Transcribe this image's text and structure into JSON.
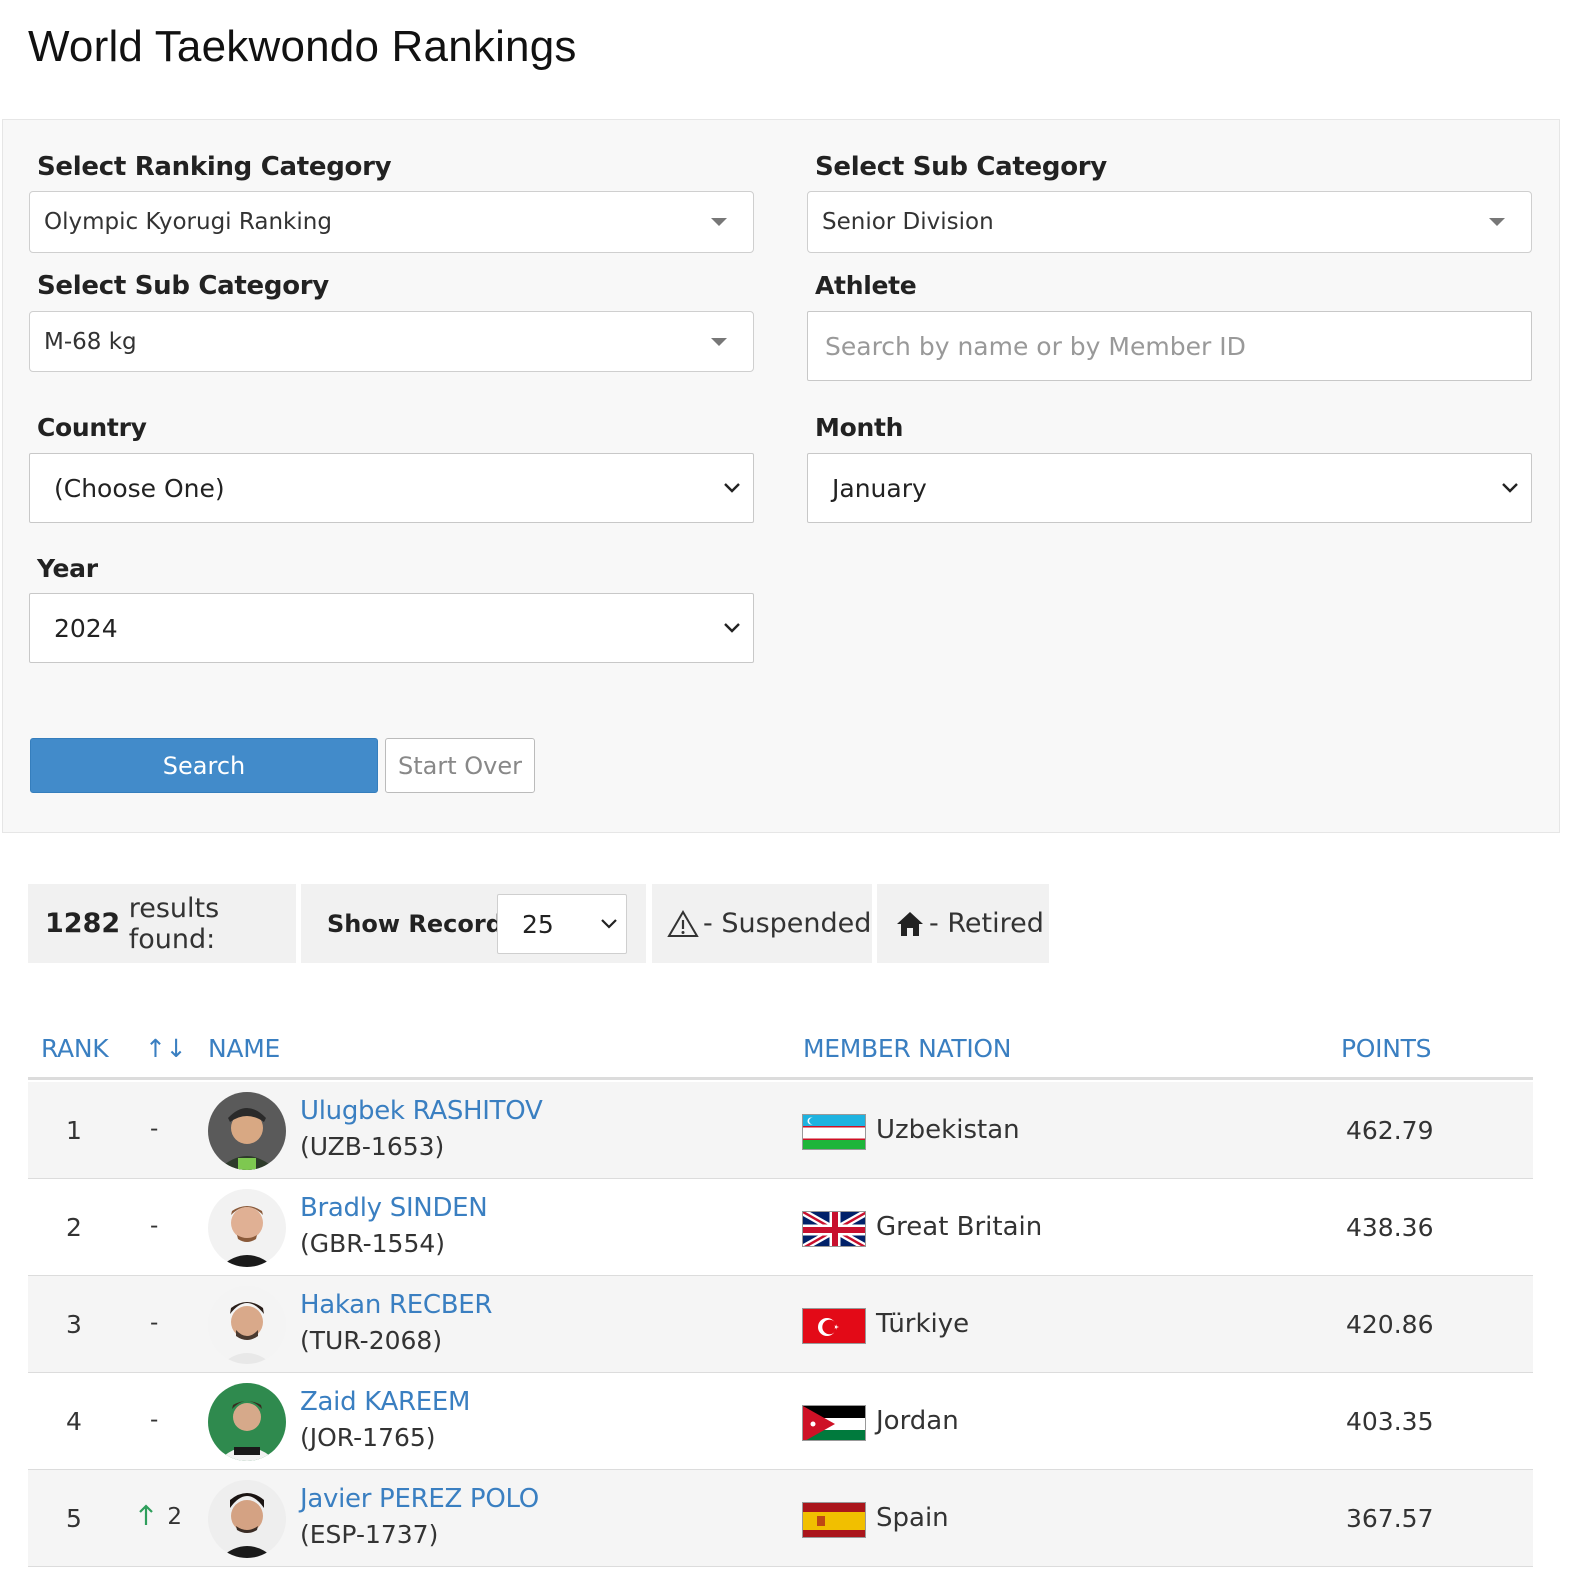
{
  "page": {
    "title": "World Taekwondo Rankings"
  },
  "filters": {
    "ranking_category": {
      "label": "Select Ranking Category",
      "value": "Olympic Kyorugi Ranking"
    },
    "sub_category_division": {
      "label": "Select Sub Category",
      "value": "Senior Division"
    },
    "sub_category_weight": {
      "label": "Select Sub Category",
      "value": "M-68 kg"
    },
    "athlete": {
      "label": "Athlete",
      "placeholder": "Search by name or by Member ID"
    },
    "country": {
      "label": "Country",
      "value": "(Choose One)"
    },
    "month": {
      "label": "Month",
      "value": "January"
    },
    "year": {
      "label": "Year",
      "value": "2024"
    },
    "search_label": "Search",
    "start_over_label": "Start Over"
  },
  "results": {
    "count": "1282",
    "count_suffix": "results found:",
    "show_records_label": "Show Records:",
    "show_records_value": "25",
    "suspended_label": "- Suspended",
    "retired_label": "- Retired"
  },
  "table": {
    "headers": {
      "rank": "RANK",
      "sort": "↑↓",
      "name": "NAME",
      "nation": "MEMBER NATION",
      "points": "POINTS"
    },
    "rows": [
      {
        "rank": "1",
        "change": "-",
        "change_dir": "none",
        "name": "Ulugbek RASHITOV",
        "member_id": "(UZB-1653)",
        "nation": "Uzbekistan",
        "flag": "uzbekistan-flag",
        "points": "462.79"
      },
      {
        "rank": "2",
        "change": "-",
        "change_dir": "none",
        "name": "Bradly SINDEN",
        "member_id": "(GBR-1554)",
        "nation": "Great Britain",
        "flag": "great-britain-flag",
        "points": "438.36"
      },
      {
        "rank": "3",
        "change": "-",
        "change_dir": "none",
        "name": "Hakan RECBER",
        "member_id": "(TUR-2068)",
        "nation": "Türkiye",
        "flag": "turkiye-flag",
        "points": "420.86"
      },
      {
        "rank": "4",
        "change": "-",
        "change_dir": "none",
        "name": "Zaid KAREEM",
        "member_id": "(JOR-1765)",
        "nation": "Jordan",
        "flag": "jordan-flag",
        "points": "403.35"
      },
      {
        "rank": "5",
        "change": "2",
        "change_dir": "up",
        "name": "Javier PEREZ POLO",
        "member_id": "(ESP-1737)",
        "nation": "Spain",
        "flag": "spain-flag",
        "points": "367.57"
      }
    ]
  },
  "colors": {
    "accent": "#428bca",
    "link": "#3a7fc1",
    "up_arrow": "#2e9e5b"
  }
}
